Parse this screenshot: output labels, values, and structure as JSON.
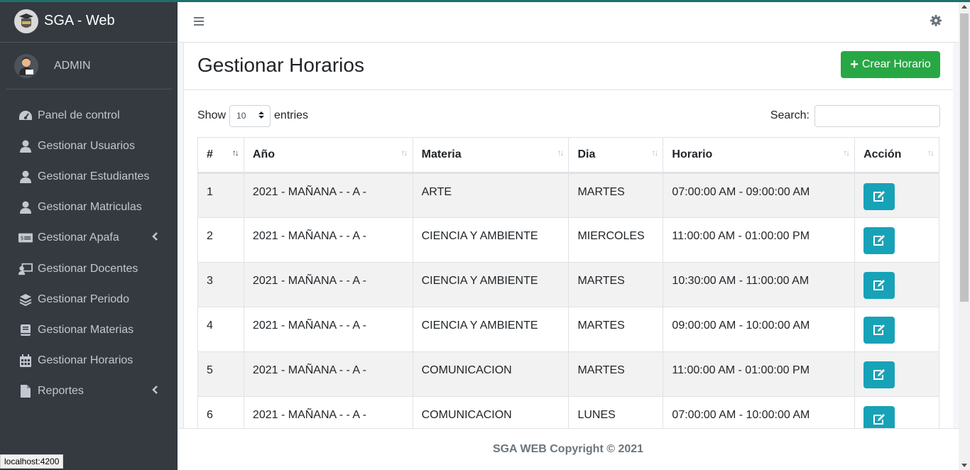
{
  "brand": {
    "title": "SGA - Web"
  },
  "user": {
    "name": "ADMIN"
  },
  "sidebar": {
    "items": [
      {
        "label": "Panel de control",
        "icon": "dashboard-gauge-icon"
      },
      {
        "label": "Gestionar Usuarios",
        "icon": "user-icon"
      },
      {
        "label": "Gestionar Estudiantes",
        "icon": "user-icon"
      },
      {
        "label": "Gestionar Matriculas",
        "icon": "user-icon"
      },
      {
        "label": "Gestionar Apafa",
        "icon": "money-bill-icon",
        "has_submenu": true
      },
      {
        "label": "Gestionar Docentes",
        "icon": "chalkboard-teacher-icon"
      },
      {
        "label": "Gestionar Periodo",
        "icon": "layer-group-icon"
      },
      {
        "label": "Gestionar Materias",
        "icon": "book-icon"
      },
      {
        "label": "Gestionar Horarios",
        "icon": "calendar-icon"
      },
      {
        "label": "Reportes",
        "icon": "file-icon",
        "has_submenu": true
      }
    ]
  },
  "status_tooltip": "localhost:4200",
  "page": {
    "title": "Gestionar Horarios",
    "create_button": "Crear Horario"
  },
  "table_controls": {
    "show_label": "Show",
    "entries_value": "10",
    "entries_label": "entries",
    "search_label": "Search:",
    "search_value": ""
  },
  "table": {
    "headers": [
      "#",
      "Año",
      "Materia",
      "Dia",
      "Horario",
      "Acción"
    ],
    "rows": [
      {
        "num": "1",
        "anio": "2021 - MAÑANA - - A -",
        "materia": "ARTE",
        "dia": "MARTES",
        "horario": "07:00:00 AM - 09:00:00 AM"
      },
      {
        "num": "2",
        "anio": "2021 - MAÑANA - - A -",
        "materia": "CIENCIA Y AMBIENTE",
        "dia": "MIERCOLES",
        "horario": "11:00:00 AM - 01:00:00 PM"
      },
      {
        "num": "3",
        "anio": "2021 - MAÑANA - - A -",
        "materia": "CIENCIA Y AMBIENTE",
        "dia": "MARTES",
        "horario": "10:30:00 AM - 11:00:00 AM"
      },
      {
        "num": "4",
        "anio": "2021 - MAÑANA - - A -",
        "materia": "CIENCIA Y AMBIENTE",
        "dia": "MARTES",
        "horario": "09:00:00 AM - 10:00:00 AM"
      },
      {
        "num": "5",
        "anio": "2021 - MAÑANA - - A -",
        "materia": "COMUNICACION",
        "dia": "MARTES",
        "horario": "11:00:00 AM - 01:00:00 PM"
      },
      {
        "num": "6",
        "anio": "2021 - MAÑANA - - A -",
        "materia": "COMUNICACION",
        "dia": "LUNES",
        "horario": "07:00:00 AM - 10:00:00 AM"
      }
    ]
  },
  "footer": {
    "text": "SGA WEB Copyright © 2021"
  },
  "colors": {
    "sidebar_bg": "#343a40",
    "create_button": "#28a745",
    "edit_button": "#17a2b8"
  }
}
